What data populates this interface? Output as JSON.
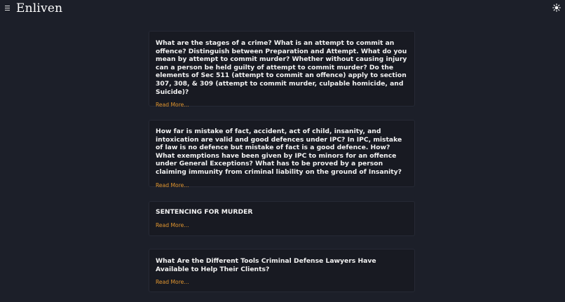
{
  "header": {
    "brand": "Enliven",
    "menu_icon": "hamburger-menu-icon",
    "theme_icon": "sun-icon"
  },
  "posts": [
    {
      "title": "What are the stages of a crime? What is an attempt to commit an offence? Distinguish between Preparation and Attempt. What do you mean by attempt to commit murder? Whether without causing injury can a person be held guilty of attempt to commit murder? Do the elements of Sec 511 (attempt to commit an offence) apply to section 307, 308, & 309 (attempt to commit murder, culpable homicide, and Suicide)?",
      "link": "Read More..."
    },
    {
      "title": "How far is mistake of fact, accident, act of child, insanity, and intoxication are valid and good defences under IPC? In IPC, mistake of law is no defence but mistake of fact is a good defence. How? What exemptions have been given by IPC to minors for an offence under General Exceptions? What has to be proved by a person claiming immunity from criminal liability on the ground of Insanity?",
      "link": "Read More..."
    },
    {
      "title": "SENTENCING FOR MURDER",
      "link": "Read More..."
    },
    {
      "title": "What Are the Different Tools Criminal Defense Lawyers Have Available to Help Their Clients?",
      "link": "Read More..."
    }
  ],
  "colors": {
    "background": "#1c1f29",
    "card": "#181a22",
    "accent_link": "#e0952f",
    "text": "#f2f2f2"
  }
}
